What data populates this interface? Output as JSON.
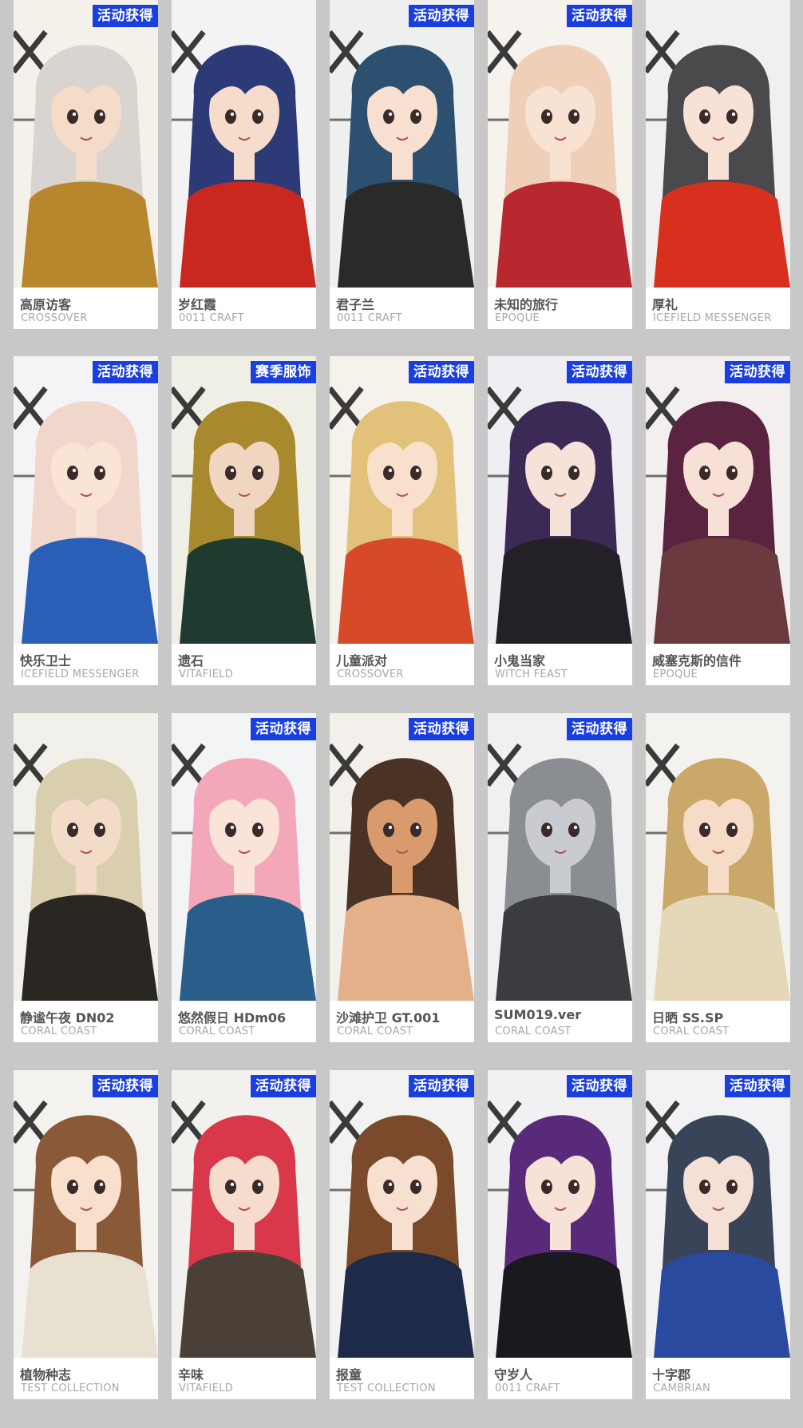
{
  "cards": [
    {
      "name": "高原访客",
      "series": "CROSSOVER",
      "badge": "活动获得",
      "colors": {
        "bg": "#f4f1ea",
        "hair": "#d9d4cf",
        "outfit": "#b8862c",
        "skin": "#f5dcc8"
      }
    },
    {
      "name": "岁红霞",
      "series": "0011 CRAFT",
      "badge": "",
      "colors": {
        "bg": "#f3f3f3",
        "hair": "#2c3a78",
        "outfit": "#c8281e",
        "skin": "#f6dccb"
      }
    },
    {
      "name": "君子兰",
      "series": "0011 CRAFT",
      "badge": "活动获得",
      "colors": {
        "bg": "#eef0f0",
        "hair": "#2d4f70",
        "outfit": "#2a2a2a",
        "skin": "#f7e0d0"
      }
    },
    {
      "name": "未知的旅行",
      "series": "EPOQUE",
      "badge": "活动获得",
      "colors": {
        "bg": "#f6f2ee",
        "hair": "#efcfb8",
        "outfit": "#b8282e",
        "skin": "#f8e2d2"
      }
    },
    {
      "name": "厚礼",
      "series": "ICEFIELD MESSENGER",
      "badge": "",
      "colors": {
        "bg": "#f2f0ee",
        "hair": "#4a4a4c",
        "outfit": "#d8301e",
        "skin": "#f7e2d5"
      }
    },
    {
      "name": "快乐卫士",
      "series": "ICEFIELD MESSENGER",
      "badge": "活动获得",
      "colors": {
        "bg": "#f4f4f6",
        "hair": "#f1d6cc",
        "outfit": "#2a5fb8",
        "skin": "#fae4d6"
      }
    },
    {
      "name": "遗石",
      "series": "VITAFIELD",
      "badge": "赛季服饰",
      "colors": {
        "bg": "#f0efe6",
        "hair": "#a9892e",
        "outfit": "#1f3b30",
        "skin": "#f0d6c0"
      }
    },
    {
      "name": "儿童派对",
      "series": "CROSSOVER",
      "badge": "活动获得",
      "colors": {
        "bg": "#f4f2ea",
        "hair": "#e2c27a",
        "outfit": "#d64a2a",
        "skin": "#f8e0cc"
      }
    },
    {
      "name": "小鬼当家",
      "series": "WITCH FEAST",
      "badge": "活动获得",
      "colors": {
        "bg": "#efeef2",
        "hair": "#3a2a55",
        "outfit": "#232027",
        "skin": "#f6e2d8"
      }
    },
    {
      "name": "威塞克斯的信件",
      "series": "EPOQUE",
      "badge": "活动获得",
      "colors": {
        "bg": "#f2efee",
        "hair": "#5a2440",
        "outfit": "#6a3a3e",
        "skin": "#f7e0d6"
      }
    },
    {
      "name": "静谧午夜 DN02",
      "series": "CORAL COAST",
      "badge": "",
      "colors": {
        "bg": "#f2f0ea",
        "hair": "#d9cfae",
        "outfit": "#2a2622",
        "skin": "#f2dcc8"
      }
    },
    {
      "name": "悠然假日 HDm06",
      "series": "CORAL COAST",
      "badge": "活动获得",
      "colors": {
        "bg": "#f2f4f6",
        "hair": "#f2a8b8",
        "outfit": "#2a5e8a",
        "skin": "#fae4da"
      }
    },
    {
      "name": "沙滩护卫 GT.001",
      "series": "CORAL COAST",
      "badge": "活动获得",
      "colors": {
        "bg": "#f3f0ec",
        "hair": "#4a3224",
        "outfit": "#e3b08a",
        "skin": "#d99a6e"
      }
    },
    {
      "name": "SUM019.ver",
      "series": "CORAL COAST",
      "badge": "活动获得",
      "colors": {
        "bg": "#f0f0f0",
        "hair": "#8a8d92",
        "outfit": "#3a3c40",
        "skin": "#c9cbd0"
      }
    },
    {
      "name": "日晒 SS.SP",
      "series": "CORAL COAST",
      "badge": "",
      "colors": {
        "bg": "#f4f2ee",
        "hair": "#c9a86a",
        "outfit": "#e4d8b8",
        "skin": "#f6dcc6"
      }
    },
    {
      "name": "植物种志",
      "series": "TEST COLLECTION",
      "badge": "活动获得",
      "colors": {
        "bg": "#f4f2ee",
        "hair": "#8a5a38",
        "outfit": "#e8e0d0",
        "skin": "#f8e0cc"
      }
    },
    {
      "name": "辛味",
      "series": "VITAFIELD",
      "badge": "活动获得",
      "colors": {
        "bg": "#f3f1ee",
        "hair": "#d8384a",
        "outfit": "#4a4038",
        "skin": "#f6dccc"
      }
    },
    {
      "name": "报童",
      "series": "TEST COLLECTION",
      "badge": "活动获得",
      "colors": {
        "bg": "#f2f2f0",
        "hair": "#7a4a2a",
        "outfit": "#1e2a4a",
        "skin": "#f7e0d0"
      }
    },
    {
      "name": "守岁人",
      "series": "0011 CRAFT",
      "badge": "活动获得",
      "colors": {
        "bg": "#f1f0f2",
        "hair": "#5a2a7a",
        "outfit": "#1a1a1e",
        "skin": "#f7e2d8"
      }
    },
    {
      "name": "十字郡",
      "series": "CAMBRIAN",
      "badge": "活动获得",
      "colors": {
        "bg": "#f2f2f4",
        "hair": "#3a4458",
        "outfit": "#2a4aa0",
        "skin": "#f5e0d6"
      }
    }
  ]
}
